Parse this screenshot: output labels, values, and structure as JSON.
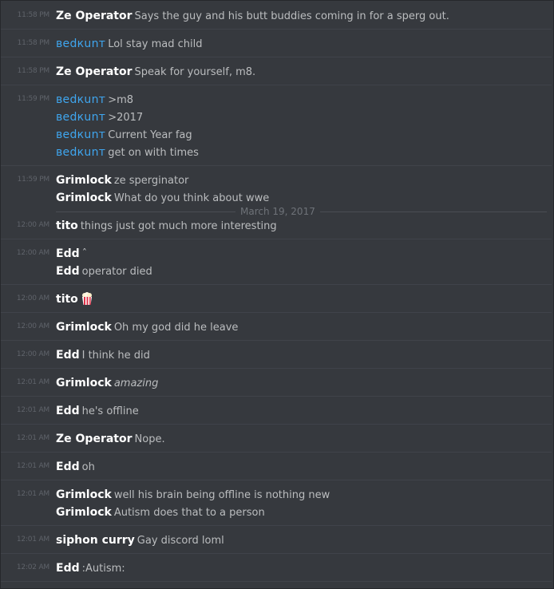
{
  "messages": [
    {
      "time": "11:58 PM",
      "lines": [
        {
          "user": "Ze Operator",
          "text": "Says the guy and his butt buddies coming in for a sperg out."
        }
      ]
    },
    {
      "time": "11:58 PM",
      "lines": [
        {
          "user": "вedкunт",
          "text": "Lol stay mad child"
        }
      ]
    },
    {
      "time": "11:58 PM",
      "lines": [
        {
          "user": "Ze Operator",
          "text": "Speak for yourself, m8."
        }
      ]
    },
    {
      "time": "11:59 PM",
      "lines": [
        {
          "user": "вedкunт",
          "text": ">m8"
        },
        {
          "user": "вedкunт",
          "text": ">2017"
        },
        {
          "user": "вedкunт",
          "text": "Current Year fag"
        },
        {
          "user": "вedкunт",
          "text": "get on with times"
        }
      ]
    },
    {
      "time": "11:59 PM",
      "lines": [
        {
          "user": "Grimlock",
          "text": "ze sperginator"
        },
        {
          "user": "Grimlock",
          "text": "What do you think about wwe"
        }
      ]
    },
    {
      "time": "12:00 AM",
      "lines": [
        {
          "user": "tito",
          "text": "things just got much more interesting"
        }
      ]
    },
    {
      "time": "12:00 AM",
      "lines": [
        {
          "user": "Edd",
          "text": "ˆ"
        },
        {
          "user": "Edd",
          "text": "operator died"
        }
      ]
    },
    {
      "time": "12:00 AM",
      "lines": [
        {
          "user": "tito",
          "text": ""
        }
      ]
    },
    {
      "time": "12:00 AM",
      "lines": [
        {
          "user": "Grimlock",
          "text": "Oh my god did he leave"
        }
      ]
    },
    {
      "time": "12:00 AM",
      "lines": [
        {
          "user": "Edd",
          "text": "I think he did"
        }
      ]
    },
    {
      "time": "12:01 AM",
      "lines": [
        {
          "user": "Grimlock",
          "text": "amazing"
        }
      ]
    },
    {
      "time": "12:01 AM",
      "lines": [
        {
          "user": "Edd",
          "text": "he's offline"
        }
      ]
    },
    {
      "time": "12:01 AM",
      "lines": [
        {
          "user": "Ze Operator",
          "text": "Nope."
        }
      ]
    },
    {
      "time": "12:01 AM",
      "lines": [
        {
          "user": "Edd",
          "text": "oh"
        }
      ]
    },
    {
      "time": "12:01 AM",
      "lines": [
        {
          "user": "Grimlock",
          "text": "well his brain being offline is nothing new"
        },
        {
          "user": "Grimlock",
          "text": "Autism does that to a person"
        }
      ]
    },
    {
      "time": "12:01 AM",
      "lines": [
        {
          "user": "siphon curry",
          "text": "Gay discord loml"
        }
      ]
    },
    {
      "time": "12:02 AM",
      "lines": [
        {
          "user": "Edd",
          "text": ":Autism:"
        }
      ]
    }
  ],
  "date_divider": "March 19, 2017",
  "emoji": {
    "popcorn": "popcorn-icon"
  },
  "colors": {
    "background": "#36393e",
    "username": "#ffffff",
    "username_alt": "#3fa6ef",
    "message_text": "#bbbdbf",
    "timestamp": "#5f636a"
  }
}
